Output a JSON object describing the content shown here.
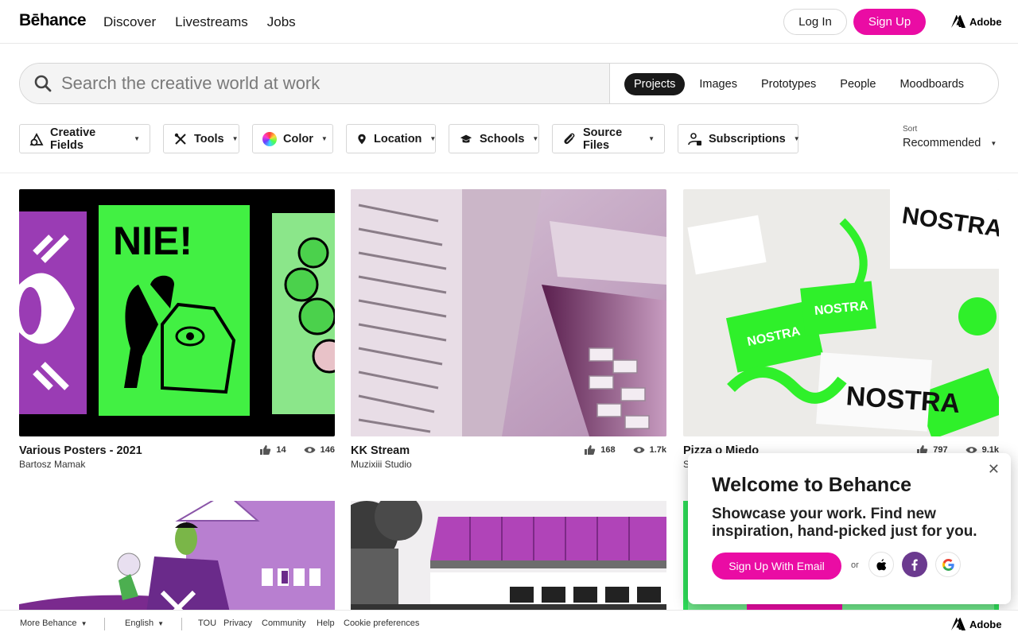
{
  "nav": {
    "logo": "Bēhance",
    "links": [
      "Discover",
      "Livestreams",
      "Jobs"
    ],
    "login": "Log In",
    "signup": "Sign Up",
    "adobe": "Adobe"
  },
  "search": {
    "placeholder": "Search the creative world at work",
    "tabs": [
      "Projects",
      "Images",
      "Prototypes",
      "People",
      "Moodboards"
    ],
    "active_tab": "Projects"
  },
  "filters": [
    {
      "label": "Creative Fields",
      "icon": "creative-fields-icon"
    },
    {
      "label": "Tools",
      "icon": "tools-icon"
    },
    {
      "label": "Color",
      "icon": "color-wheel-icon"
    },
    {
      "label": "Location",
      "icon": "location-pin-icon"
    },
    {
      "label": "Schools",
      "icon": "graduation-cap-icon"
    },
    {
      "label": "Source Files",
      "icon": "paperclip-icon"
    },
    {
      "label": "Subscriptions",
      "icon": "subscriptions-icon"
    }
  ],
  "sort": {
    "label": "Sort",
    "value": "Recommended"
  },
  "projects": [
    {
      "title": "Various Posters - 2021",
      "owner": "Bartosz Mamak",
      "likes": "14",
      "views": "146"
    },
    {
      "title": "KK Stream",
      "owner": "Muzixiii Studio",
      "likes": "168",
      "views": "1.7k"
    },
    {
      "title": "Pizza o Miedo",
      "owner": "S",
      "likes": "797",
      "views": "9.1k"
    }
  ],
  "popup": {
    "title": "Welcome to Behance",
    "text": "Showcase your work. Find new inspiration, hand-picked just for you.",
    "button": "Sign Up With Email",
    "or": "or"
  },
  "footer": {
    "more": "More Behance",
    "language": "English",
    "links": [
      "TOU",
      "Privacy",
      "Community",
      "Help",
      "Cookie preferences"
    ],
    "adobe": "Adobe"
  },
  "colors": {
    "brand_pink": "#ea0ca4",
    "dark": "#191919",
    "facebook_purple": "#6b3a8f"
  }
}
